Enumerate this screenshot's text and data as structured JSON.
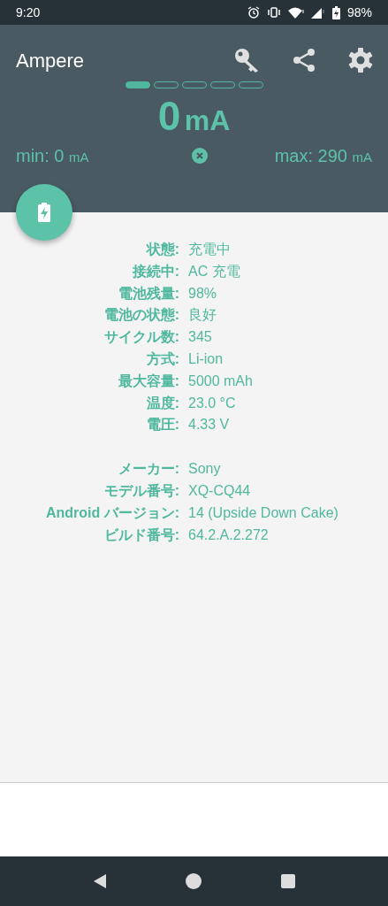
{
  "status_bar": {
    "time": "9:20",
    "battery": "98%"
  },
  "app_bar": {
    "title": "Ampere"
  },
  "pages": [
    {
      "selected": true
    },
    {
      "selected": false
    },
    {
      "selected": false
    },
    {
      "selected": false
    },
    {
      "selected": false
    }
  ],
  "current": {
    "value": "0",
    "unit": "mA"
  },
  "min": {
    "label": "min: 0",
    "unit": "mA"
  },
  "max": {
    "label": "max: 290",
    "unit": "mA"
  },
  "sections": [
    [
      {
        "label": "状態:",
        "value": "充電中"
      },
      {
        "label": "接続中:",
        "value": "AC 充電"
      },
      {
        "label": "電池残量:",
        "value": "98%"
      },
      {
        "label": "電池の状態:",
        "value": "良好"
      },
      {
        "label": "サイクル数:",
        "value": "345"
      },
      {
        "label": "方式:",
        "value": "Li-ion"
      },
      {
        "label": "最大容量:",
        "value": "5000 mAh"
      },
      {
        "label": "温度:",
        "value": "23.0 °C"
      },
      {
        "label": "電圧:",
        "value": "4.33 V"
      }
    ],
    [
      {
        "label": "メーカー:",
        "value": "Sony"
      },
      {
        "label": "モデル番号:",
        "value": "XQ-CQ44"
      },
      {
        "label": "Android バージョン:",
        "value": "14 (Upside Down Cake)"
      },
      {
        "label": "ビルド番号:",
        "value": "64.2.A.2.272"
      }
    ]
  ]
}
